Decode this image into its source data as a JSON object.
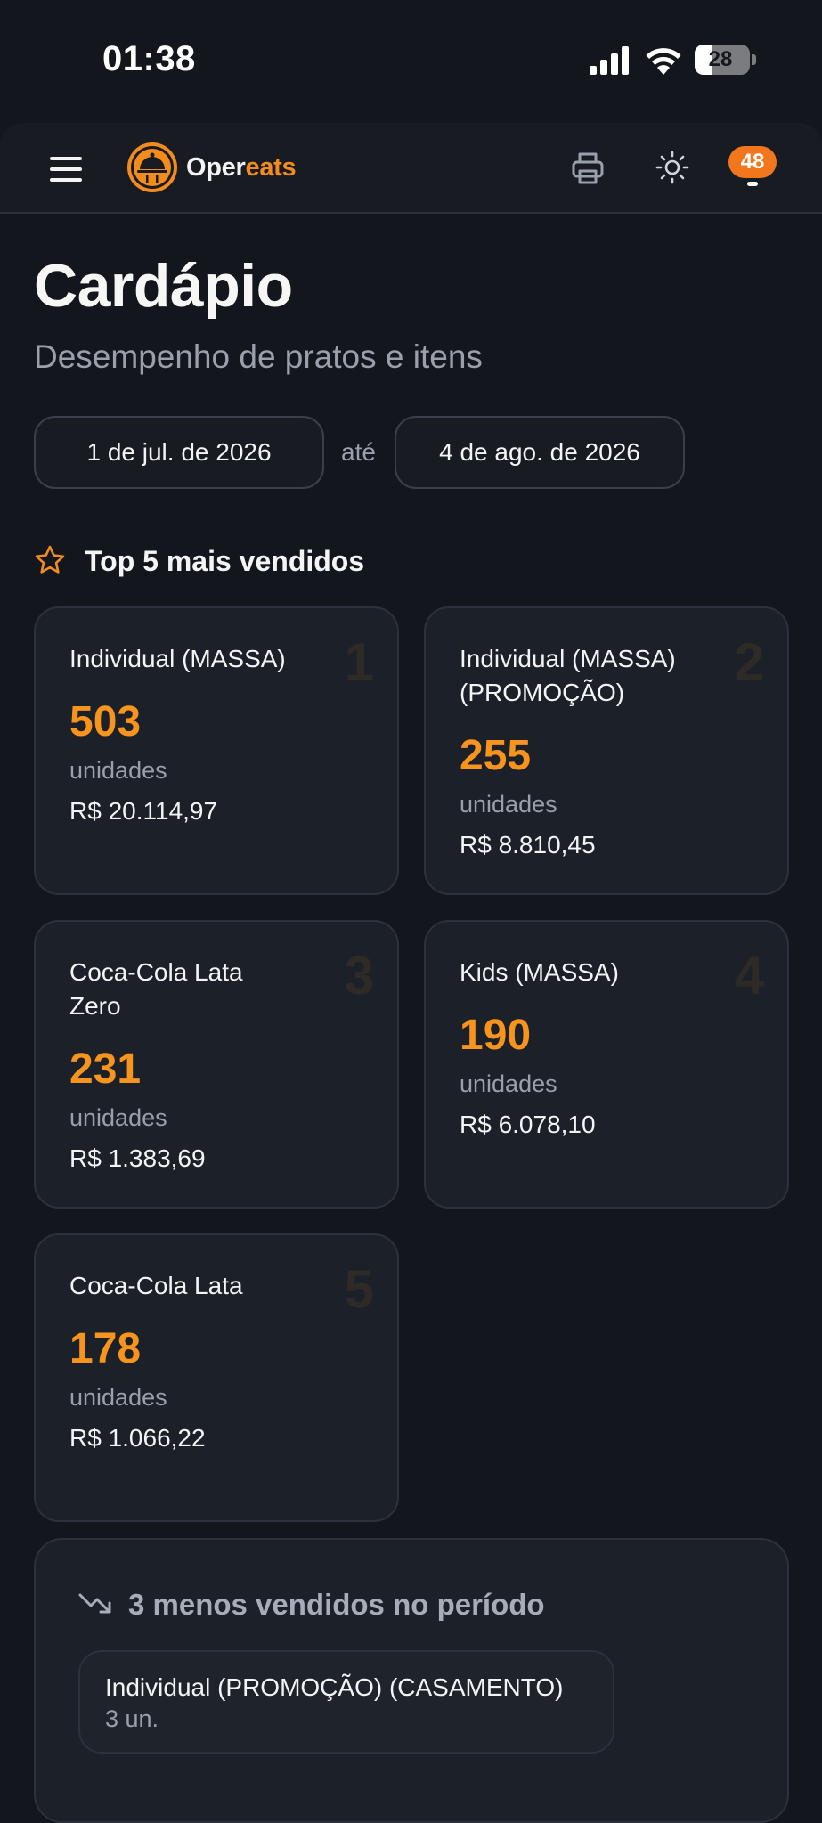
{
  "status_bar": {
    "time": "01:38",
    "battery_level": "28",
    "icons": [
      "signal-icon",
      "wifi-icon",
      "battery-icon"
    ]
  },
  "app_bar": {
    "brand_part1": "Oper",
    "brand_part2": "eats",
    "notification_count": "48",
    "icons": [
      "menu-icon",
      "logo-icon",
      "printer-icon",
      "sun-icon",
      "bell-icon"
    ]
  },
  "page": {
    "title": "Cardápio",
    "subtitle": "Desempenho de pratos e itens"
  },
  "date_range": {
    "from": "1 de jul. de 2026",
    "separator": "até",
    "to": "4 de ago. de 2026"
  },
  "top_section": {
    "title": "Top 5 mais vendidos",
    "items": [
      {
        "rank": "1",
        "name": "Individual (MASSA)",
        "quantity": "503",
        "unit": "unidades",
        "revenue": "R$ 20.114,97"
      },
      {
        "rank": "2",
        "name": "Individual (MASSA) (PROMOÇÃO)",
        "quantity": "255",
        "unit": "unidades",
        "revenue": "R$ 8.810,45"
      },
      {
        "rank": "3",
        "name": "Coca-Cola Lata Zero",
        "quantity": "231",
        "unit": "unidades",
        "revenue": "R$ 1.383,69"
      },
      {
        "rank": "4",
        "name": "Kids (MASSA)",
        "quantity": "190",
        "unit": "unidades",
        "revenue": "R$ 6.078,10"
      },
      {
        "rank": "5",
        "name": "Coca-Cola Lata",
        "quantity": "178",
        "unit": "unidades",
        "revenue": "R$ 1.066,22"
      }
    ]
  },
  "least_section": {
    "title": "3 menos vendidos no período",
    "items": [
      {
        "name": "Individual (PROMOÇÃO) (CASAMENTO)",
        "quantity": "3 un."
      }
    ]
  },
  "colors": {
    "background": "#13161c",
    "card": "#1c2028",
    "accent": "#f7941d",
    "badge": "#f2761c"
  }
}
